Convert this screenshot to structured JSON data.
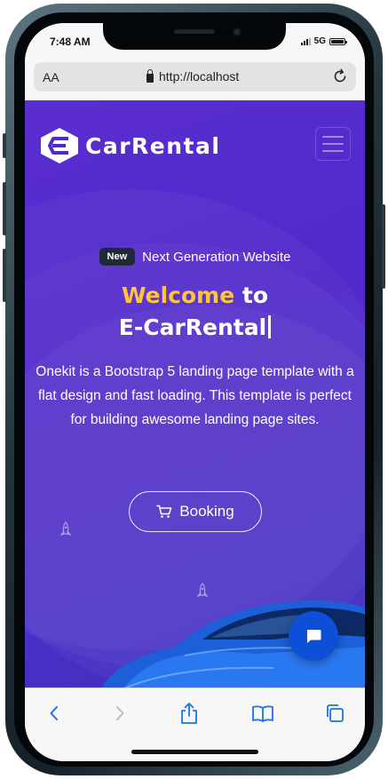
{
  "status_bar": {
    "time": "7:48 AM",
    "network": "5G"
  },
  "browser": {
    "text_size_label": "AA",
    "url": "http://localhost"
  },
  "navbar": {
    "brand": "CarRental"
  },
  "hero": {
    "badge": "New",
    "tagline": "Next Generation Website",
    "headline_highlight": "Welcome",
    "headline_line1_rest": " to",
    "headline_line2": "E-CarRental",
    "description": "Onekit is a Bootstrap 5 landing page template with a flat design and fast loading. This template is perfect for building awesome landing page sites.",
    "cta_label": "Booking"
  },
  "colors": {
    "hero_bg": "#5129cb",
    "highlight": "#ffc43a",
    "chat_button": "#0d4fd6",
    "toolbar_icon": "#1a73e8"
  },
  "toolbar": {
    "icons": [
      "back-icon",
      "forward-icon",
      "share-icon",
      "bookmarks-icon",
      "tabs-icon"
    ]
  }
}
